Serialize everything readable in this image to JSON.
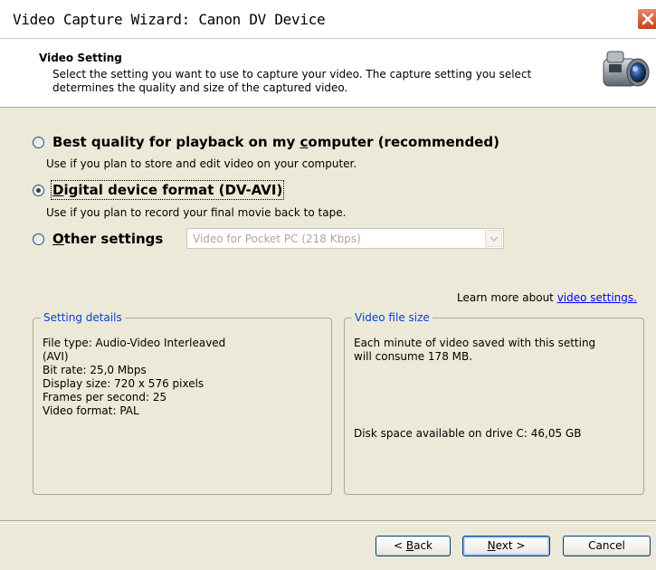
{
  "window": {
    "title": "Video Capture Wizard: Canon DV Device",
    "close_icon": "close-icon"
  },
  "header": {
    "title": "Video Setting",
    "description": "Select the setting you want to use to capture your video. The capture setting you select determines the quality and size of the captured video.",
    "icon": "video-camera-icon"
  },
  "options": {
    "best_quality": {
      "label_pre": "Best quality for playback on my ",
      "label_mn": "c",
      "label_post": "omputer (recommended)",
      "description": "Use if you plan to store and edit video on your computer.",
      "selected": false
    },
    "digital": {
      "label_mn": "D",
      "label_post": "igital device format (DV-AVI)",
      "description": "Use if you plan to record your final movie back to tape.",
      "selected": true
    },
    "other": {
      "label_mn": "O",
      "label_post": "ther settings",
      "selected": false,
      "combo_value": "Video for Pocket PC (218 Kbps)"
    }
  },
  "learn_more": {
    "prefix": "Learn more about ",
    "link": "video settings."
  },
  "setting_details": {
    "legend": "Setting details",
    "lines": [
      "File type: Audio-Video Interleaved",
      "(AVI)",
      "Bit rate: 25,0 Mbps",
      "Display size: 720 x 576 pixels",
      "Frames per second: 25",
      "Video format: PAL"
    ]
  },
  "file_size": {
    "legend": "Video file size",
    "description": "Each minute of video saved with this setting will consume 178 MB.",
    "disk_space": "Disk space available on drive C: 46,05 GB"
  },
  "buttons": {
    "back_pre": "< ",
    "back_mn": "B",
    "back_post": "ack",
    "next_mn": "N",
    "next_post": "ext >",
    "cancel": "Cancel"
  }
}
